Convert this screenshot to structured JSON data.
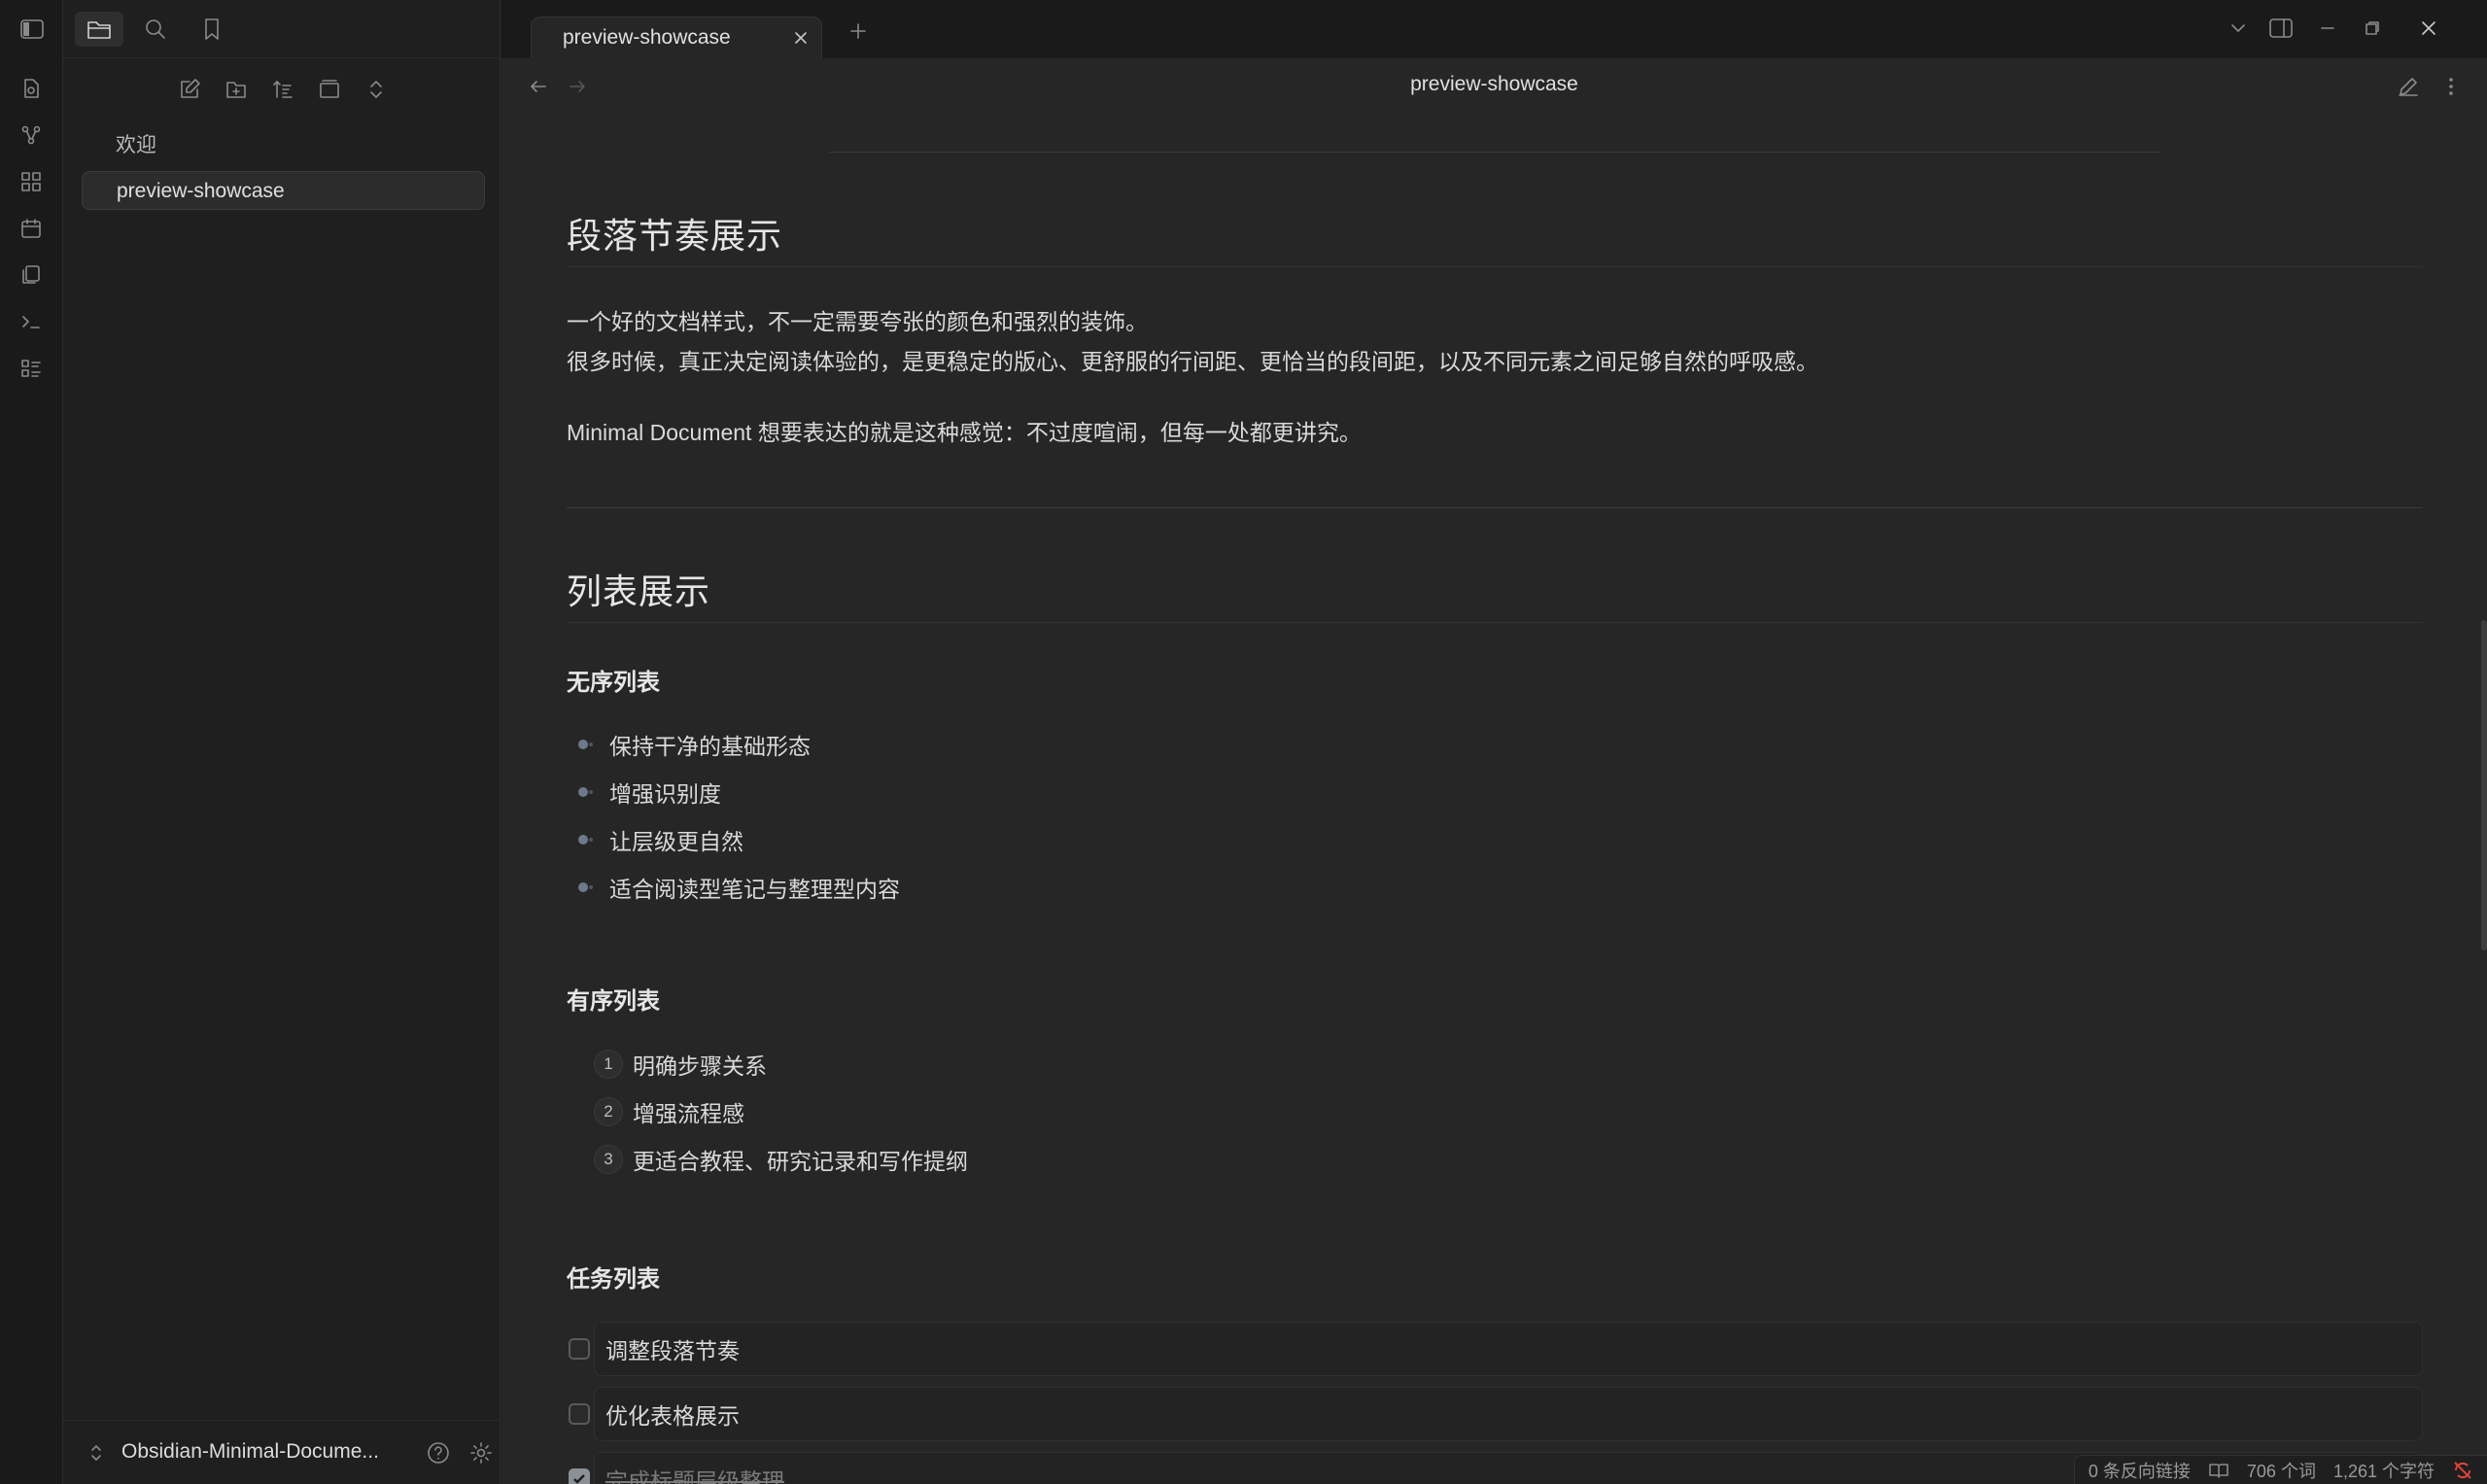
{
  "app": {
    "vault_name": "Obsidian-Minimal-Docume...",
    "accent_color": "#6d7a8a"
  },
  "sidebar": {
    "tabs": [
      {
        "icon": "folder-icon",
        "active": true
      },
      {
        "icon": "search-icon",
        "active": false
      },
      {
        "icon": "bookmark-icon",
        "active": false
      }
    ],
    "files": [
      {
        "label": "欢迎",
        "active": false
      },
      {
        "label": "preview-showcase",
        "active": true
      }
    ]
  },
  "ribbon": {
    "items": [
      "open-file-icon",
      "graph-icon",
      "canvas-icon",
      "calendar-icon",
      "templates-icon",
      "terminal-icon",
      "tasks-icon"
    ]
  },
  "tabs": {
    "active_title": "preview-showcase"
  },
  "view": {
    "title": "preview-showcase"
  },
  "doc": {
    "section1": {
      "title": "段落节奏展示",
      "p1_line1": "一个好的文档样式，不一定需要夸张的颜色和强烈的装饰。",
      "p1_line2": "很多时候，真正决定阅读体验的，是更稳定的版心、更舒服的行间距、更恰当的段间距，以及不同元素之间足够自然的呼吸感。",
      "p2": "Minimal Document 想要表达的就是这种感觉：不过度喧闹，但每一处都更讲究。"
    },
    "section2": {
      "title": "列表展示",
      "unordered": {
        "title": "无序列表",
        "items": [
          "保持干净的基础形态",
          "增强识别度",
          "让层级更自然",
          "适合阅读型笔记与整理型内容"
        ]
      },
      "ordered": {
        "title": "有序列表",
        "items": [
          {
            "num": "1",
            "text": "明确步骤关系"
          },
          {
            "num": "2",
            "text": "增强流程感"
          },
          {
            "num": "3",
            "text": "更适合教程、研究记录和写作提纲"
          }
        ]
      },
      "tasks": {
        "title": "任务列表",
        "items": [
          {
            "text": "调整段落节奏",
            "checked": false
          },
          {
            "text": "优化表格展示",
            "checked": false
          },
          {
            "text": "完成标题层级整理",
            "checked": true
          }
        ]
      }
    }
  },
  "status": {
    "backlinks": "0 条反向链接",
    "words": "706 个词",
    "chars": "1,261 个字符"
  }
}
